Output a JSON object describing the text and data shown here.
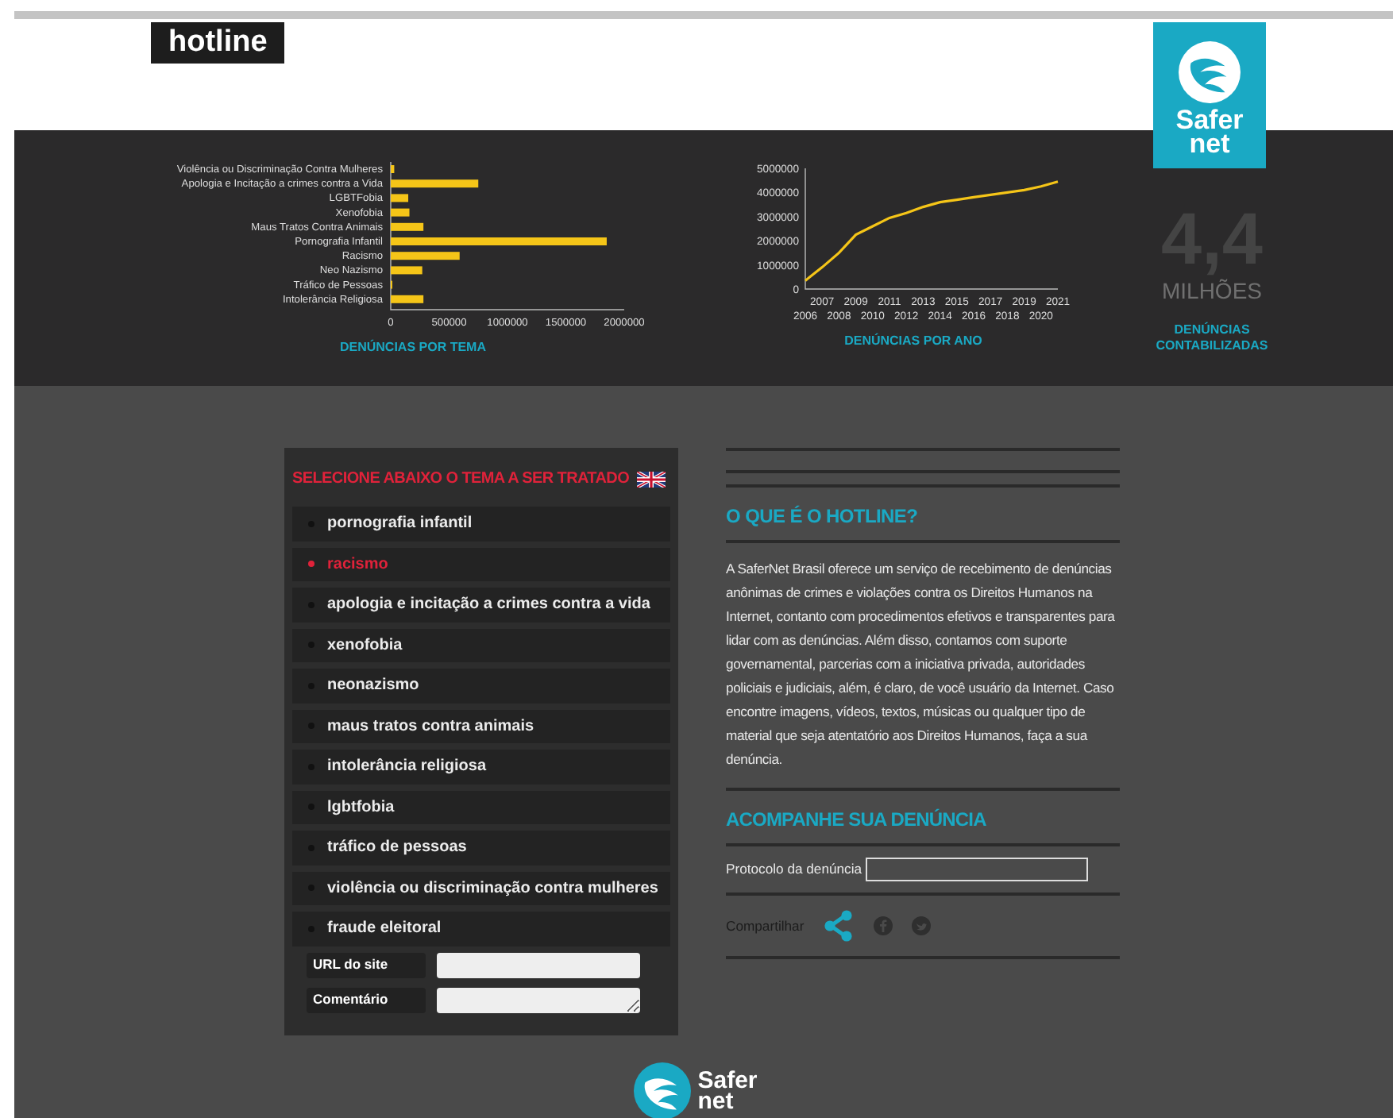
{
  "header": {
    "title": "hotline",
    "logo": {
      "line1": "Safer",
      "line2": "net"
    }
  },
  "stats": {
    "chart_by_theme": {
      "caption": "DENÚNCIAS POR TEMA",
      "chart_data": {
        "type": "bar",
        "orientation": "horizontal",
        "categories": [
          "Violência ou Discriminação Contra Mulheres",
          "Apologia e Incitação a crimes contra a Vida",
          "LGBTFobia",
          "Xenofobia",
          "Maus Tratos Contra Animais",
          "Pornografia Infantil",
          "Racismo",
          "Neo Nazismo",
          "Tráfico de Pessoas",
          "Intolerância Religiosa"
        ],
        "series": [
          {
            "color": "#f5c518",
            "values": [
              30000,
              750000,
              150000,
              160000,
              280000,
              1850000,
              590000,
              270000,
              10000,
              280000
            ]
          }
        ],
        "xlim": [
          0,
          2000000
        ],
        "xticks": [
          0,
          500000,
          1000000,
          1500000,
          2000000
        ]
      }
    },
    "chart_by_year": {
      "caption": "DENÚNCIAS POR ANO",
      "chart_data": {
        "type": "line",
        "x": [
          "2006",
          "2007",
          "2008",
          "2009",
          "2010",
          "2011",
          "2012",
          "2013",
          "2014",
          "2015",
          "2016",
          "2017",
          "2018",
          "2019",
          "2020",
          "2021"
        ],
        "series": [
          {
            "color": "#f5c518",
            "values": [
              350000,
              900000,
              1500000,
              2250000,
              2600000,
              2950000,
              3150000,
              3400000,
              3600000,
              3700000,
              3800000,
              3900000,
              4000000,
              4100000,
              4250000,
              4450000
            ]
          }
        ],
        "ylim": [
          0,
          5000000
        ],
        "yticks": [
          0,
          1000000,
          2000000,
          3000000,
          4000000,
          5000000
        ]
      }
    },
    "total": {
      "value": "4,4",
      "unit": "MILHÕES",
      "caption": "DENÚNCIAS CONTABILIZADAS"
    }
  },
  "form": {
    "title": "SELECIONE ABAIXO O TEMA A SER TRATADO",
    "topics": [
      {
        "label": "pornografia infantil",
        "selected": false
      },
      {
        "label": "racismo",
        "selected": true
      },
      {
        "label": "apologia e incitação a crimes contra a vida",
        "selected": false
      },
      {
        "label": "xenofobia",
        "selected": false
      },
      {
        "label": "neonazismo",
        "selected": false
      },
      {
        "label": "maus tratos contra animais",
        "selected": false
      },
      {
        "label": "intolerância religiosa",
        "selected": false
      },
      {
        "label": "lgbtfobia",
        "selected": false
      },
      {
        "label": "tráfico de pessoas",
        "selected": false
      },
      {
        "label": "violência ou discriminação contra mulheres",
        "selected": false
      },
      {
        "label": "fraude eleitoral",
        "selected": false
      }
    ],
    "fields": [
      {
        "label": "URL do site",
        "kind": "input"
      },
      {
        "label": "Comentário",
        "kind": "textarea"
      }
    ]
  },
  "info": {
    "title": "O QUE É O HOTLINE?",
    "text": "A SaferNet Brasil oferece um serviço de recebimento de denúncias anônimas de crimes e violações contra os Direitos Humanos na Internet, contanto com procedimentos efetivos e transparentes para lidar com as denúncias. Além disso, contamos com suporte governamental, parcerias com a iniciativa privada, autoridades policiais e judiciais, além, é claro, de você usuário da Internet. Caso encontre imagens, vídeos, textos, músicas ou qualquer tipo de material que seja atentatório aos Direitos Humanos, faça a sua denúncia.",
    "track_title": "ACOMPANHE SUA DENÚNCIA",
    "protocol_label": "Protocolo da denúncia",
    "share_label": "Compartilhar"
  },
  "footer": {
    "logo": {
      "line1": "Safer",
      "line2": "net"
    }
  }
}
